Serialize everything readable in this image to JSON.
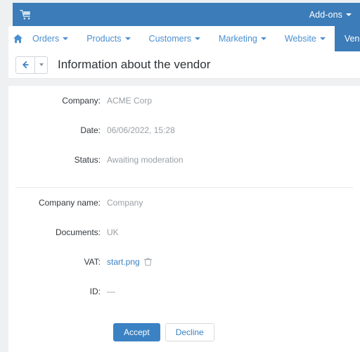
{
  "topbar": {
    "cart_icon": "cart-icon",
    "addons_label": "Add-ons",
    "caret_icon": "chevron-down-icon",
    "background_color": "#3b7cb9"
  },
  "nav": {
    "home_icon": "home-icon",
    "items": [
      {
        "label": "Orders",
        "caret": "chevron-down-icon",
        "active": false
      },
      {
        "label": "Products",
        "caret": "chevron-down-icon",
        "active": false
      },
      {
        "label": "Customers",
        "caret": "chevron-down-icon",
        "active": false
      },
      {
        "label": "Marketing",
        "caret": "chevron-down-icon",
        "active": false
      },
      {
        "label": "Website",
        "caret": "chevron-down-icon",
        "active": false
      },
      {
        "label": "Vendors",
        "caret": "chevron-down-icon",
        "active": true
      }
    ],
    "link_color": "#4a8fd0",
    "active_background": "#3b7cb9"
  },
  "page_header": {
    "back_icon": "arrow-left-icon",
    "split_icon": "chevron-down-icon",
    "title": "Information about the vendor"
  },
  "form": {
    "group_one": [
      {
        "label": "Company:",
        "value": "ACME Corp"
      },
      {
        "label": "Date:",
        "value": "06/06/2022, 15:28"
      },
      {
        "label": "Status:",
        "value": "Awaiting moderation"
      }
    ],
    "group_two": [
      {
        "label": "Company name:",
        "value": "Company"
      },
      {
        "label": "Documents:",
        "value": "UK"
      }
    ],
    "vat": {
      "label": "VAT:",
      "file_name": "start.png",
      "delete_icon": "trash-icon"
    },
    "id": {
      "label": "ID:",
      "value": "—"
    }
  },
  "actions": {
    "accept_label": "Accept",
    "decline_label": "Decline",
    "accept_color": "#3b82c4"
  }
}
